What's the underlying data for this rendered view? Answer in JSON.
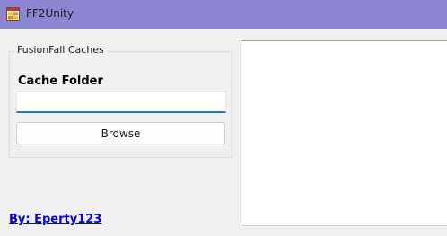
{
  "window": {
    "title": "FF2Unity",
    "icon": "app-window-icon"
  },
  "group": {
    "legend": "FusionFall Caches",
    "cache_label": "Cache Folder",
    "cache_value": "",
    "browse_label": "Browse"
  },
  "output": {
    "text": ""
  },
  "footer": {
    "author_link": "By: Eperty123"
  },
  "colors": {
    "titlebar": "#8c87d2",
    "input_focus": "#1e78c8",
    "link": "#0000ee"
  }
}
